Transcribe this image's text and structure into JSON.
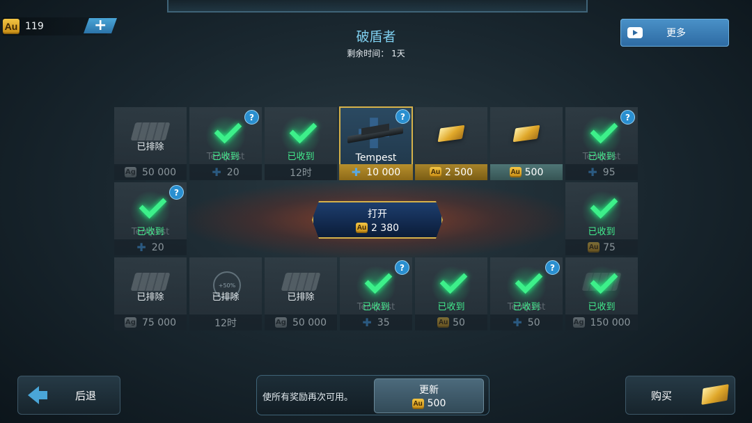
{
  "header": {
    "gold_amount": "119",
    "gold_currency": "Au",
    "title": "破盾者",
    "time_left": "剩余时间： 1天",
    "more_label": "更多"
  },
  "grid": {
    "r0c0": {
      "status": "已排除",
      "currency": "Ag",
      "price": "50 000"
    },
    "r0c1": {
      "status": "已收到",
      "ghost": "Tempest",
      "price": "20"
    },
    "r0c2": {
      "status": "已收到",
      "price": "12时"
    },
    "r0c3": {
      "label": "Tempest",
      "price": "10 000"
    },
    "r0c4": {
      "currency": "Au",
      "price": "2 500"
    },
    "r0c5": {
      "currency": "Au",
      "price": "500"
    },
    "r0c6": {
      "status": "已收到",
      "ghost": "Tempest",
      "price": "95"
    },
    "r1c0": {
      "status": "已收到",
      "ghost": "Tempest",
      "price": "20"
    },
    "r1c6": {
      "status": "已收到",
      "currency": "Au",
      "price": "75"
    },
    "r2c0": {
      "status": "已排除",
      "currency": "Ag",
      "price": "75 000"
    },
    "r2c1": {
      "status": "已排除",
      "laurel": "+50%",
      "price": "12时"
    },
    "r2c2": {
      "status": "已排除",
      "currency": "Ag",
      "price": "50 000"
    },
    "r2c3": {
      "status": "已收到",
      "ghost": "Tempest",
      "price": "35"
    },
    "r2c4": {
      "status": "已收到",
      "currency": "Au",
      "price": "50"
    },
    "r2c5": {
      "status": "已收到",
      "ghost": "Tempest",
      "price": "50"
    },
    "r2c6": {
      "status": "已收到",
      "currency": "Ag",
      "price": "150 000"
    },
    "help_mark": "?"
  },
  "open_button": {
    "label": "打开",
    "currency": "Au",
    "price": "2 380"
  },
  "footer": {
    "back_label": "后退",
    "refresh_desc": "使所有奖励再次可用。",
    "refresh_label": "更新",
    "refresh_currency": "Au",
    "refresh_price": "500",
    "buy_label": "购买"
  }
}
